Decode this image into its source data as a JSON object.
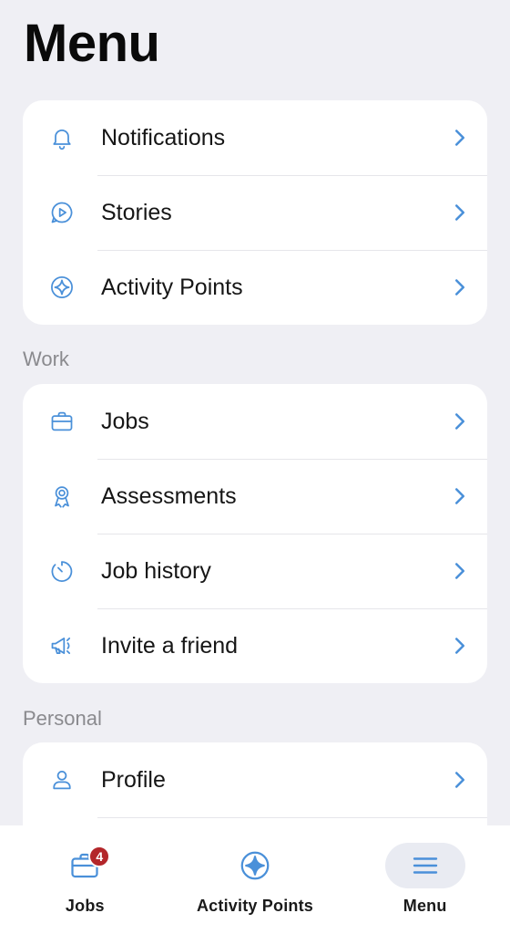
{
  "page": {
    "title": "Menu"
  },
  "colors": {
    "accent": "#4a90d9",
    "background": "#efeff4",
    "badge": "#b3262a"
  },
  "top_group": {
    "items": [
      {
        "label": "Notifications",
        "icon": "bell-icon"
      },
      {
        "label": "Stories",
        "icon": "play-bubble-icon"
      },
      {
        "label": "Activity Points",
        "icon": "sparkle-circle-icon"
      }
    ]
  },
  "work": {
    "section_label": "Work",
    "items": [
      {
        "label": "Jobs",
        "icon": "briefcase-icon"
      },
      {
        "label": "Assessments",
        "icon": "award-ribbon-icon"
      },
      {
        "label": "Job history",
        "icon": "timer-icon"
      },
      {
        "label": "Invite a friend",
        "icon": "megaphone-icon"
      }
    ]
  },
  "personal": {
    "section_label": "Personal",
    "items": [
      {
        "label": "Profile",
        "icon": "person-icon"
      }
    ]
  },
  "tabbar": {
    "tabs": [
      {
        "label": "Jobs",
        "icon": "briefcase-icon",
        "badge": "4"
      },
      {
        "label": "Activity Points",
        "icon": "sparkle-circle-icon"
      },
      {
        "label": "Menu",
        "icon": "hamburger-icon",
        "selected": true
      }
    ]
  }
}
